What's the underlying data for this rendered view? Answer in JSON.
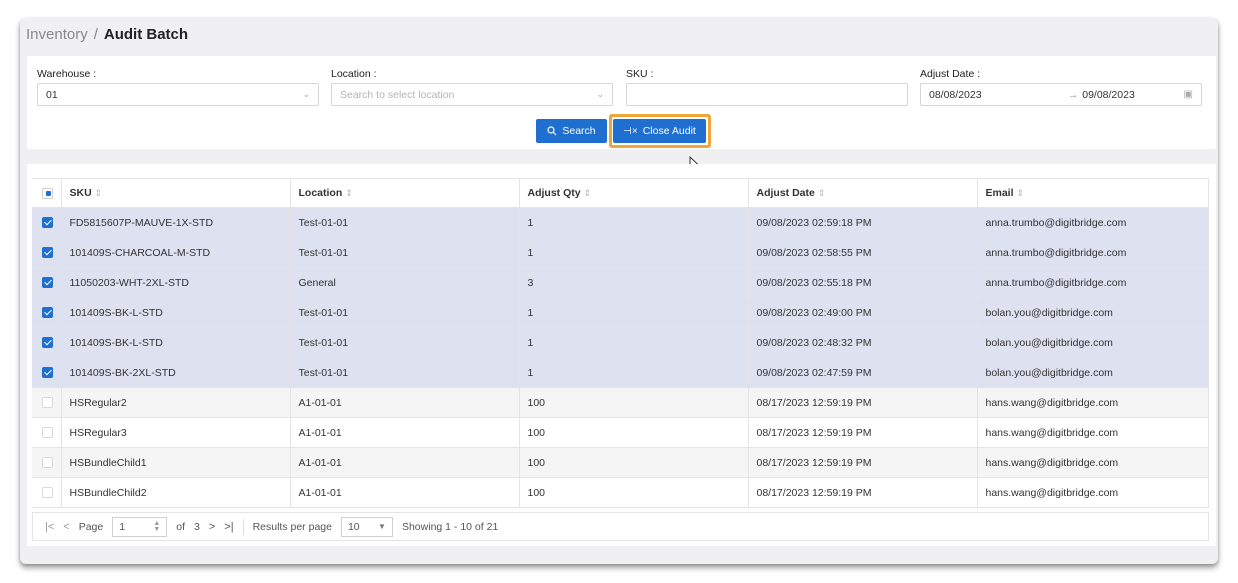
{
  "breadcrumb": {
    "parent": "Inventory",
    "separator": "/",
    "current": "Audit Batch"
  },
  "filters": {
    "warehouse": {
      "label": "Warehouse :",
      "value": "01"
    },
    "location": {
      "label": "Location :",
      "placeholder": "Search to select location"
    },
    "sku": {
      "label": "SKU :",
      "value": ""
    },
    "adjust_date": {
      "label": "Adjust Date :",
      "from": "08/08/2023",
      "to": "09/08/2023"
    }
  },
  "buttons": {
    "search": "Search",
    "close_audit": "Close Audit"
  },
  "table": {
    "columns": [
      "SKU",
      "Location",
      "Adjust Qty",
      "Adjust Date",
      "Email"
    ],
    "rows": [
      {
        "checked": true,
        "sku": "FD5815607P-MAUVE-1X-STD",
        "location": "Test-01-01",
        "qty": "1",
        "date": "09/08/2023 02:59:18 PM",
        "email": "anna.trumbo@digitbridge.com"
      },
      {
        "checked": true,
        "sku": "101409S-CHARCOAL-M-STD",
        "location": "Test-01-01",
        "qty": "1",
        "date": "09/08/2023 02:58:55 PM",
        "email": "anna.trumbo@digitbridge.com"
      },
      {
        "checked": true,
        "sku": "11050203-WHT-2XL-STD",
        "location": "General",
        "qty": "3",
        "date": "09/08/2023 02:55:18 PM",
        "email": "anna.trumbo@digitbridge.com"
      },
      {
        "checked": true,
        "sku": "101409S-BK-L-STD",
        "location": "Test-01-01",
        "qty": "1",
        "date": "09/08/2023 02:49:00 PM",
        "email": "bolan.you@digitbridge.com"
      },
      {
        "checked": true,
        "sku": "101409S-BK-L-STD",
        "location": "Test-01-01",
        "qty": "1",
        "date": "09/08/2023 02:48:32 PM",
        "email": "bolan.you@digitbridge.com"
      },
      {
        "checked": true,
        "sku": "101409S-BK-2XL-STD",
        "location": "Test-01-01",
        "qty": "1",
        "date": "09/08/2023 02:47:59 PM",
        "email": "bolan.you@digitbridge.com"
      },
      {
        "checked": false,
        "sku": "HSRegular2",
        "location": "A1-01-01",
        "qty": "100",
        "date": "08/17/2023 12:59:19 PM",
        "email": "hans.wang@digitbridge.com"
      },
      {
        "checked": false,
        "sku": "HSRegular3",
        "location": "A1-01-01",
        "qty": "100",
        "date": "08/17/2023 12:59:19 PM",
        "email": "hans.wang@digitbridge.com"
      },
      {
        "checked": false,
        "sku": "HSBundleChild1",
        "location": "A1-01-01",
        "qty": "100",
        "date": "08/17/2023 12:59:19 PM",
        "email": "hans.wang@digitbridge.com"
      },
      {
        "checked": false,
        "sku": "HSBundleChild2",
        "location": "A1-01-01",
        "qty": "100",
        "date": "08/17/2023 12:59:19 PM",
        "email": "hans.wang@digitbridge.com"
      }
    ]
  },
  "pagination": {
    "page_label": "Page",
    "page": "1",
    "of_label": "of",
    "total_pages": "3",
    "per_page_label": "Results per page",
    "per_page": "10",
    "showing": "Showing 1 - 10 of 21"
  },
  "colors": {
    "primary": "#1f6fd1",
    "highlight": "#f0a43a",
    "selected_row": "#dde1f0"
  }
}
